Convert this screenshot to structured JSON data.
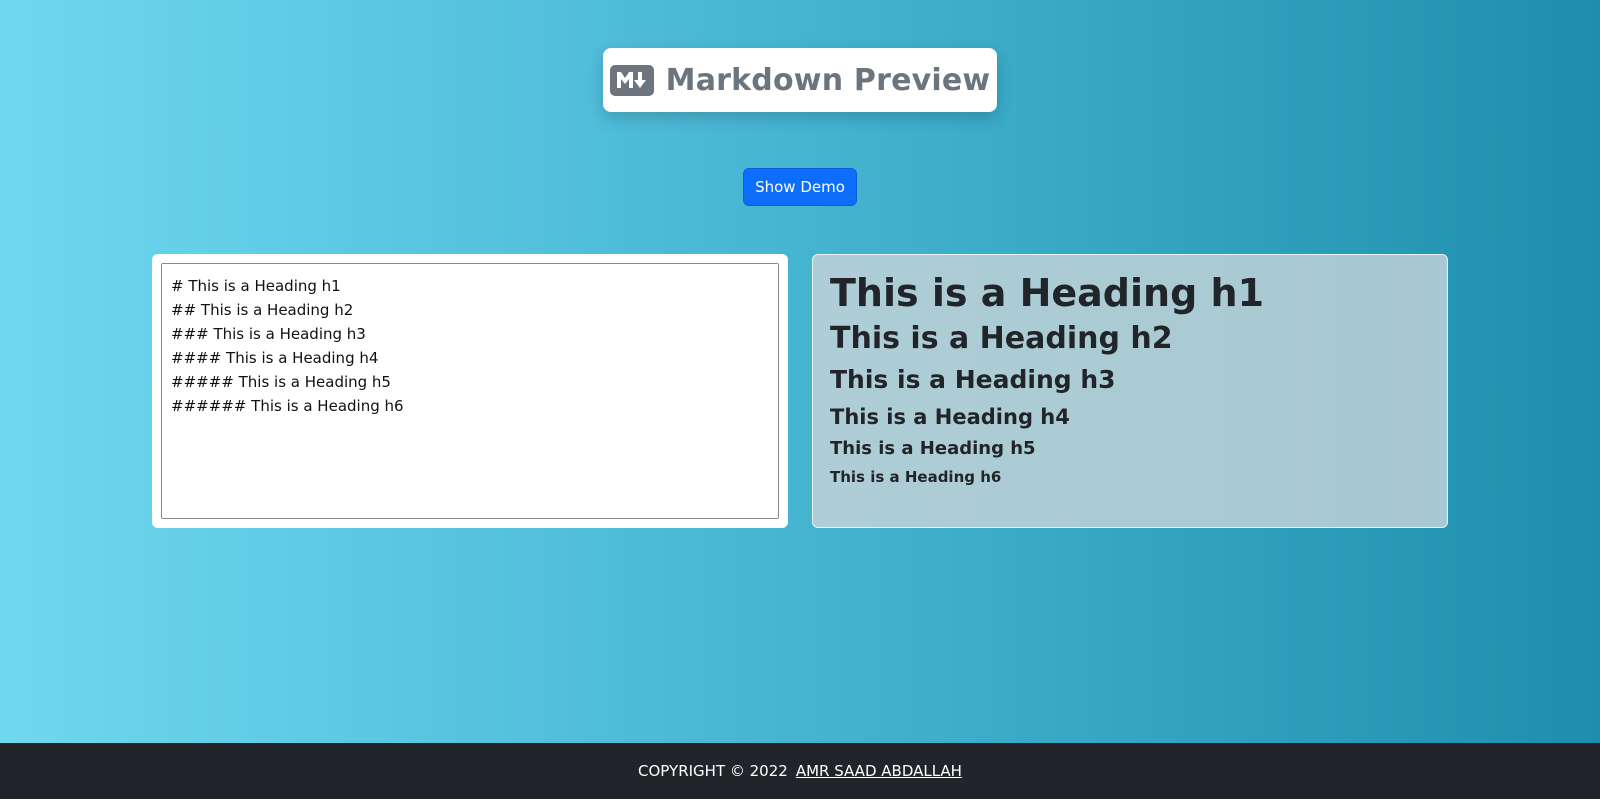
{
  "header": {
    "title": "Markdown Preview",
    "logo_icon": "markdown-icon"
  },
  "demo_button": {
    "label": "Show Demo",
    "color": "#0d6efd"
  },
  "editor": {
    "value": "# This is a Heading h1\n## This is a Heading h2\n### This is a Heading h3\n#### This is a Heading h4\n##### This is a Heading h5\n###### This is a Heading h6"
  },
  "preview": {
    "h1": "This is a Heading h1",
    "h2": "This is a Heading h2",
    "h3": "This is a Heading h3",
    "h4": "This is a Heading h4",
    "h5": "This is a Heading h5",
    "h6": "This is a Heading h6"
  },
  "footer": {
    "copyright": "COPYRIGHT © 2022",
    "author": "AMR SAAD ABDALLAH"
  }
}
